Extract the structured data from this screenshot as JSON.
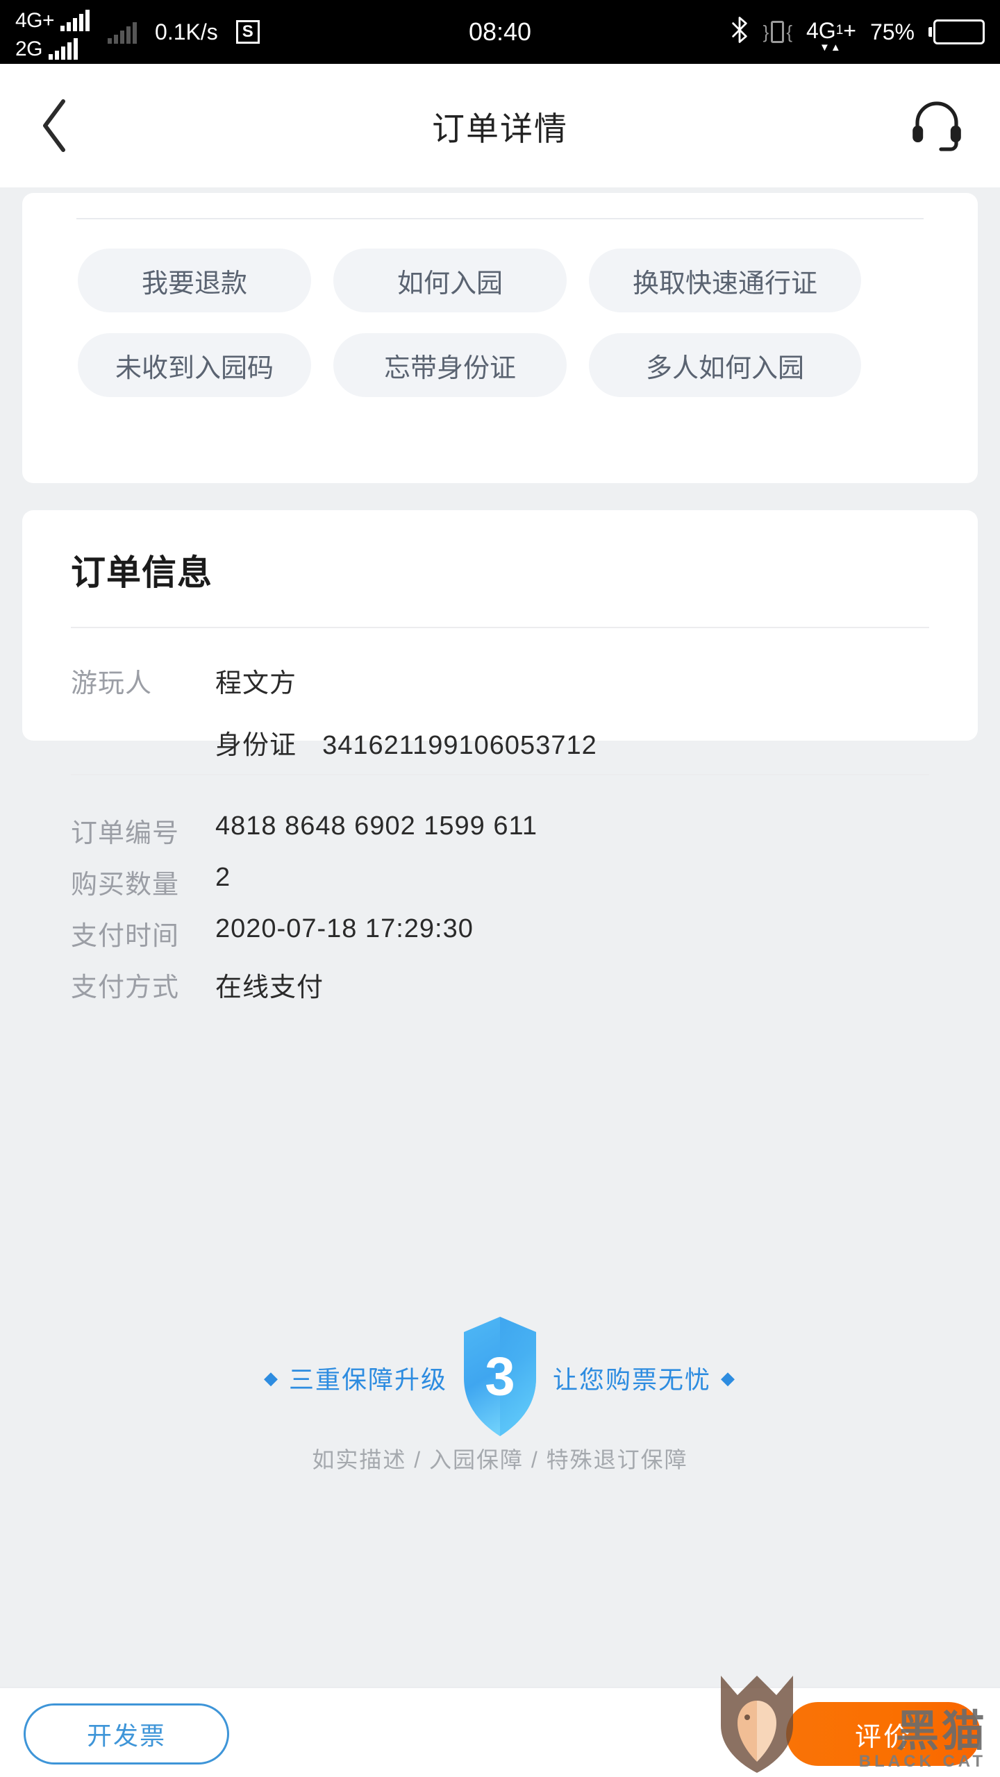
{
  "statusbar": {
    "sim1_network": "4G+",
    "sim2_network": "2G",
    "net_speed": "0.1K/s",
    "screenshot_badge": "S",
    "clock": "08:40",
    "bluetooth_icon": "bluetooth-icon",
    "vibrate_icon": "vibrate-icon",
    "data_network": "4G",
    "data_network_sub": "1",
    "data_network_plus": "+",
    "battery_percent": "75%"
  },
  "navbar": {
    "back_icon": "back-chevron-icon",
    "title": "订单详情",
    "service_icon": "headset-icon"
  },
  "faq": {
    "chips": [
      {
        "label": "我要退款"
      },
      {
        "label": "如何入园"
      },
      {
        "label": "换取快速通行证"
      },
      {
        "label": "未收到入园码"
      },
      {
        "label": "忘带身份证"
      },
      {
        "label": "多人如何入园"
      }
    ]
  },
  "order_info": {
    "title": "订单信息",
    "traveler": {
      "label": "游玩人",
      "name": "程文方",
      "id_label": "身份证",
      "id_number": "341621199106053712"
    },
    "rows": [
      {
        "label": "订单编号",
        "value": "4818 8648 6902 1599 611"
      },
      {
        "label": "购买数量",
        "value": "2"
      },
      {
        "label": "支付时间",
        "value": "2020-07-18 17:29:30"
      },
      {
        "label": "支付方式",
        "value": "在线支付"
      }
    ]
  },
  "guarantee": {
    "left_text": "三重保障升级",
    "right_text": "让您购票无忧",
    "shield_number": "3",
    "subtitle": "如实描述 / 入园保障 / 特殊退订保障",
    "accent_color": "#2d8ce0"
  },
  "bottombar": {
    "invoice_label": "开发票",
    "rate_label": "评价",
    "invoice_color": "#3e95d8",
    "rate_color": "#fa6f00"
  },
  "watermark": {
    "cn": "黑猫",
    "en": "BLACK CAT"
  }
}
